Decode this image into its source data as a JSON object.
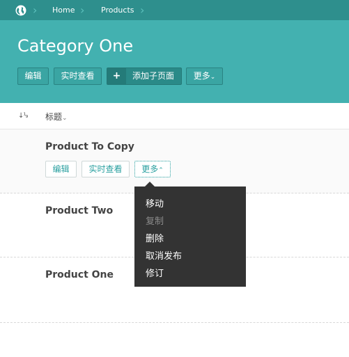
{
  "breadcrumb": {
    "items": [
      "Home",
      "Products"
    ]
  },
  "header": {
    "title": "Category One",
    "buttons": {
      "edit": "编辑",
      "live_view": "实时查看",
      "add_child": "添加子页面",
      "more": "更多"
    }
  },
  "table": {
    "column_title": "标题",
    "sort_icon_text": "↓¹₉"
  },
  "rows": [
    {
      "title": "Product To Copy",
      "actions": {
        "edit": "编辑",
        "live_view": "实时查看",
        "more": "更多"
      }
    },
    {
      "title": "Product Two"
    },
    {
      "title": "Product One"
    }
  ],
  "dropdown": {
    "items": [
      {
        "label": "移动",
        "disabled": false
      },
      {
        "label": "复制",
        "disabled": true
      },
      {
        "label": "删除",
        "disabled": false
      },
      {
        "label": "取消发布",
        "disabled": false
      },
      {
        "label": "修订",
        "disabled": false
      }
    ]
  },
  "colors": {
    "header_bg": "#43b1b0",
    "breadcrumb_bg": "#2e8f8d",
    "accent_text": "#2aa0a0",
    "menu_bg": "#333333"
  }
}
